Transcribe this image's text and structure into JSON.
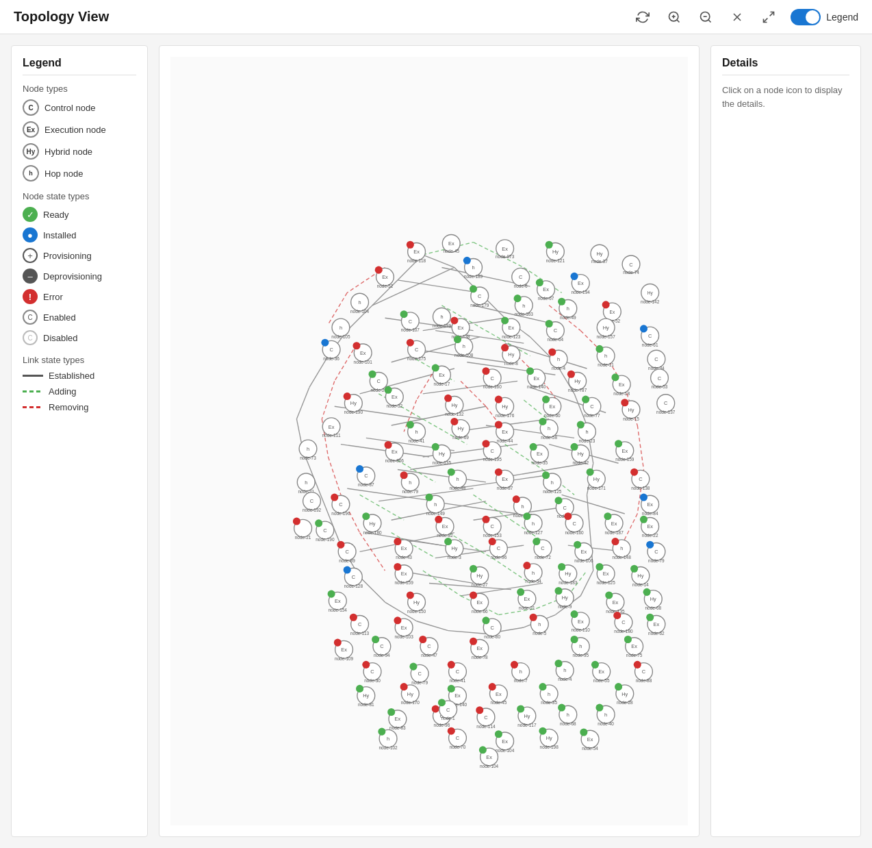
{
  "header": {
    "title": "Topology View",
    "legend_label": "Legend"
  },
  "toolbar": {
    "refresh_icon": "↺",
    "zoom_in_icon": "🔍",
    "zoom_out_icon": "🔍",
    "close_icon": "✕",
    "fullscreen_icon": "⛶"
  },
  "legend": {
    "title": "Legend",
    "node_types_label": "Node types",
    "node_types": [
      {
        "id": "control",
        "abbr": "C",
        "label": "Control node"
      },
      {
        "id": "execution",
        "abbr": "Ex",
        "label": "Execution node"
      },
      {
        "id": "hybrid",
        "abbr": "Hy",
        "label": "Hybrid node"
      },
      {
        "id": "hop",
        "abbr": "h",
        "label": "Hop node"
      }
    ],
    "node_state_label": "Node state types",
    "node_states": [
      {
        "id": "ready",
        "label": "Ready"
      },
      {
        "id": "installed",
        "label": "Installed"
      },
      {
        "id": "provisioning",
        "label": "Provisioning"
      },
      {
        "id": "deprovisioning",
        "label": "Deprovisioning"
      },
      {
        "id": "error",
        "label": "Error"
      },
      {
        "id": "enabled",
        "label": "Enabled"
      },
      {
        "id": "disabled",
        "label": "Disabled"
      }
    ],
    "link_state_label": "Link state types",
    "link_states": [
      {
        "id": "established",
        "label": "Established"
      },
      {
        "id": "adding",
        "label": "Adding"
      },
      {
        "id": "removing",
        "label": "Removing"
      }
    ]
  },
  "details": {
    "title": "Details",
    "hint": "Click on a node icon to display the details."
  }
}
